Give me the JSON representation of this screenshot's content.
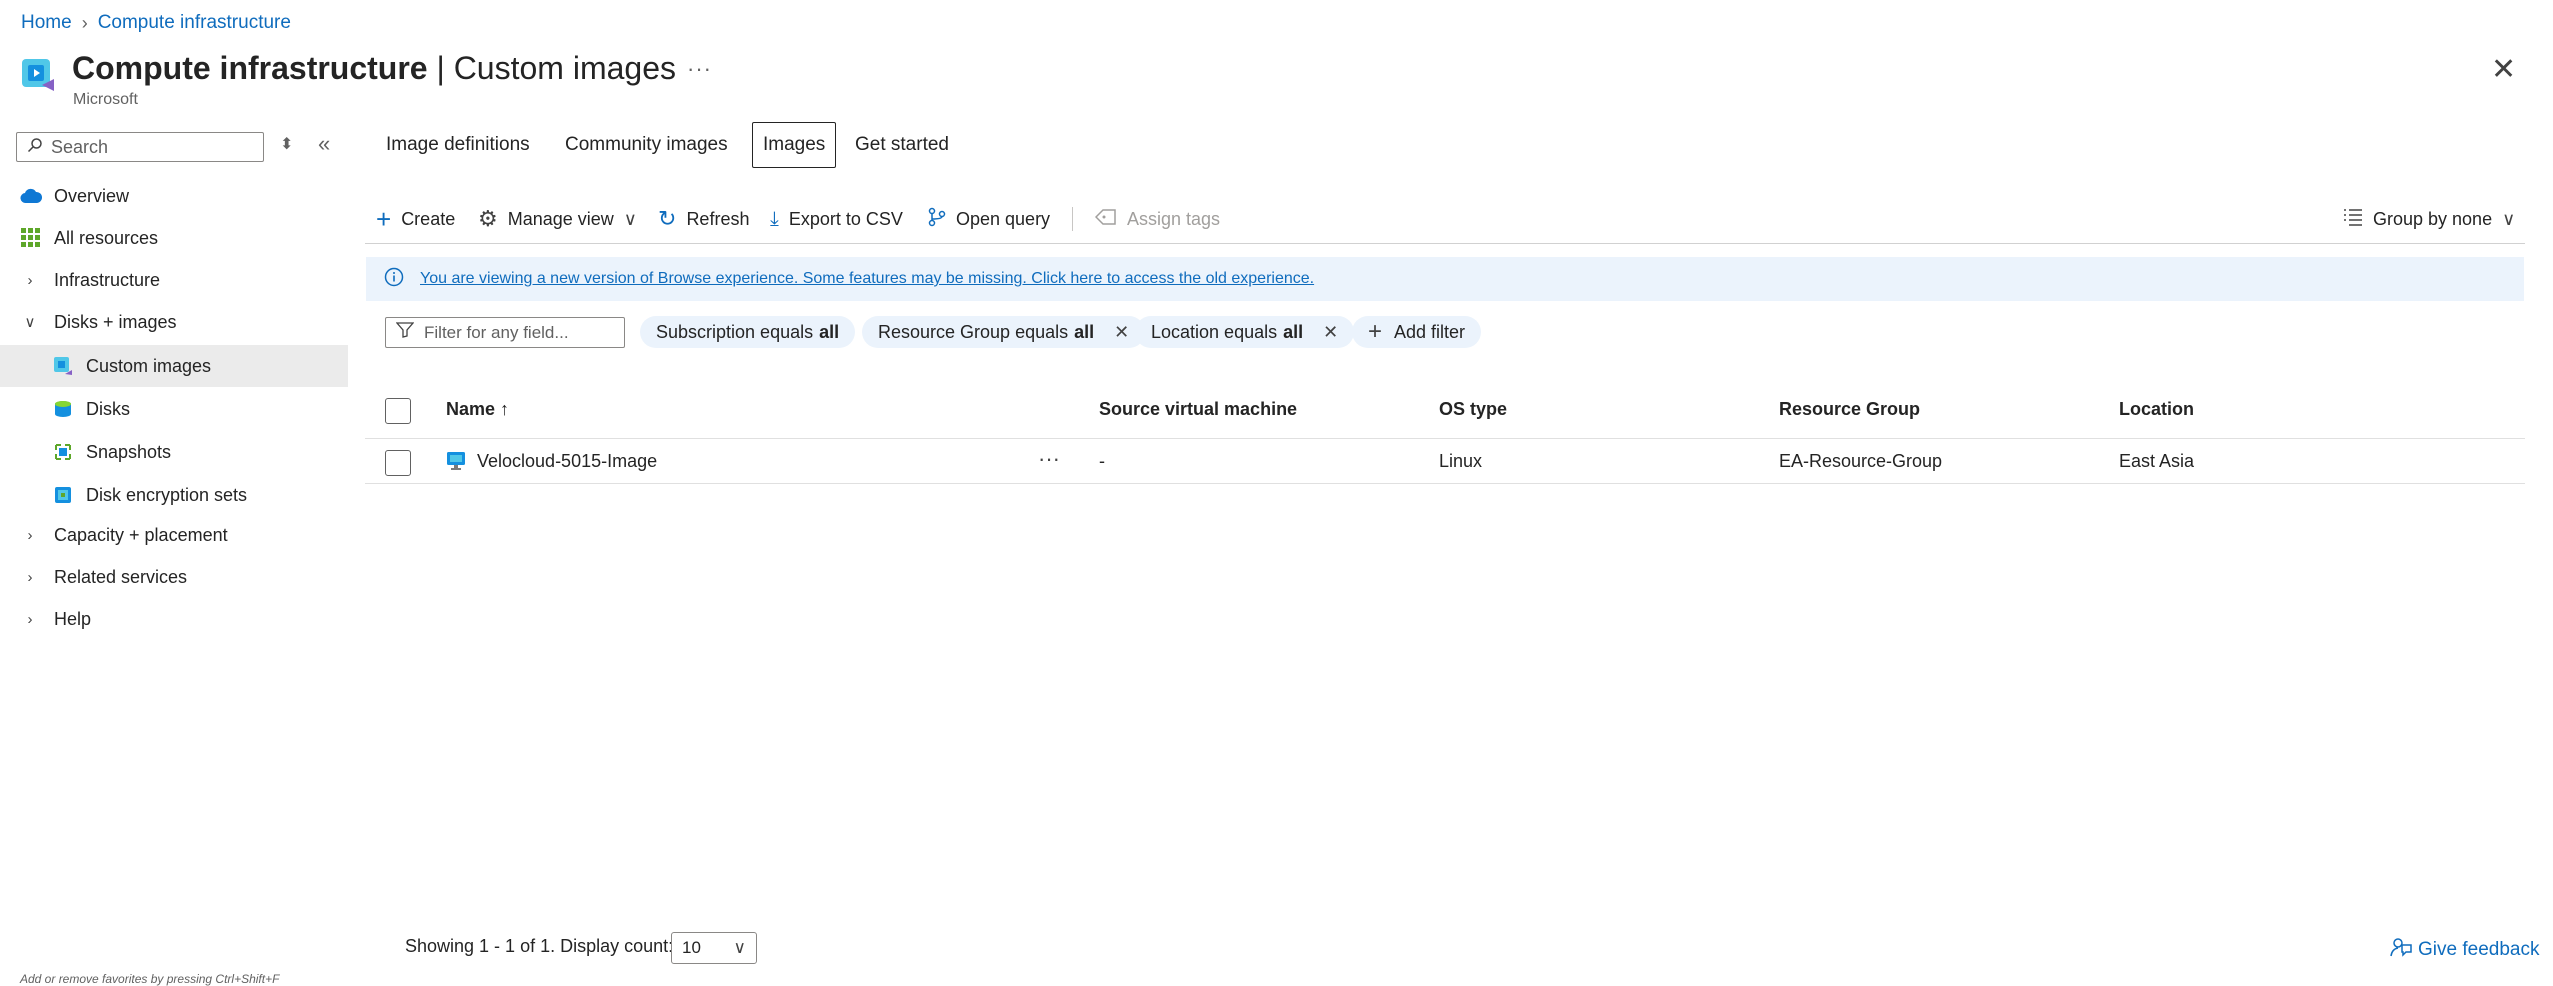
{
  "breadcrumb": {
    "home": "Home",
    "current": "Compute infrastructure"
  },
  "header": {
    "title_main": "Compute infrastructure",
    "title_separator": " | ",
    "title_section": "Custom images",
    "subtitle": "Microsoft",
    "more": "···",
    "close": "✕"
  },
  "sidebar": {
    "search_placeholder": "Search",
    "items": [
      {
        "label": "Overview",
        "icon": "cloud-icon"
      },
      {
        "label": "All resources",
        "icon": "grid-icon"
      },
      {
        "label": "Infrastructure",
        "icon": "chevron-right-icon"
      },
      {
        "label": "Disks + images",
        "icon": "chevron-down-icon"
      },
      {
        "label": "Custom images",
        "icon": "custom-image-icon"
      },
      {
        "label": "Disks",
        "icon": "disk-icon"
      },
      {
        "label": "Snapshots",
        "icon": "snapshot-icon"
      },
      {
        "label": "Disk encryption sets",
        "icon": "encryption-icon"
      },
      {
        "label": "Capacity + placement",
        "icon": "chevron-right-icon"
      },
      {
        "label": "Related services",
        "icon": "chevron-right-icon"
      },
      {
        "label": "Help",
        "icon": "chevron-right-icon"
      }
    ],
    "hint": "Add or remove favorites by pressing Ctrl+Shift+F"
  },
  "tabs": [
    {
      "label": "Image definitions"
    },
    {
      "label": "Community images"
    },
    {
      "label": "Images",
      "active": true
    },
    {
      "label": "Get started"
    }
  ],
  "toolbar": {
    "create": "Create",
    "manage_view": "Manage view",
    "refresh": "Refresh",
    "export_csv": "Export to CSV",
    "open_query": "Open query",
    "assign_tags": "Assign tags",
    "group_by": "Group by none"
  },
  "banner": {
    "text": "You are viewing a new version of Browse experience. Some features may be missing. Click here to access the old experience."
  },
  "filters": {
    "placeholder": "Filter for any field...",
    "pills": [
      {
        "prefix": "Subscription equals ",
        "value": "all"
      },
      {
        "prefix": "Resource Group equals ",
        "value": "all"
      },
      {
        "prefix": "Location equals ",
        "value": "all"
      }
    ],
    "add_filter": "Add filter"
  },
  "table": {
    "columns": [
      "Name ↑",
      "Source virtual machine",
      "OS type",
      "Resource Group",
      "Location"
    ],
    "rows": [
      {
        "name": "Velocloud-5015-Image",
        "more": "···",
        "source_vm": "-",
        "os_type": "Linux",
        "resource_group": "EA-Resource-Group",
        "location": "East Asia"
      }
    ]
  },
  "footer": {
    "showing": "Showing 1 - 1 of 1. Display count:",
    "display_count": "10",
    "feedback": "Give feedback"
  },
  "colors": {
    "accent": "#0f6cbd",
    "banner_bg": "#ebf3fc",
    "selected_bg": "#ebebeb"
  }
}
